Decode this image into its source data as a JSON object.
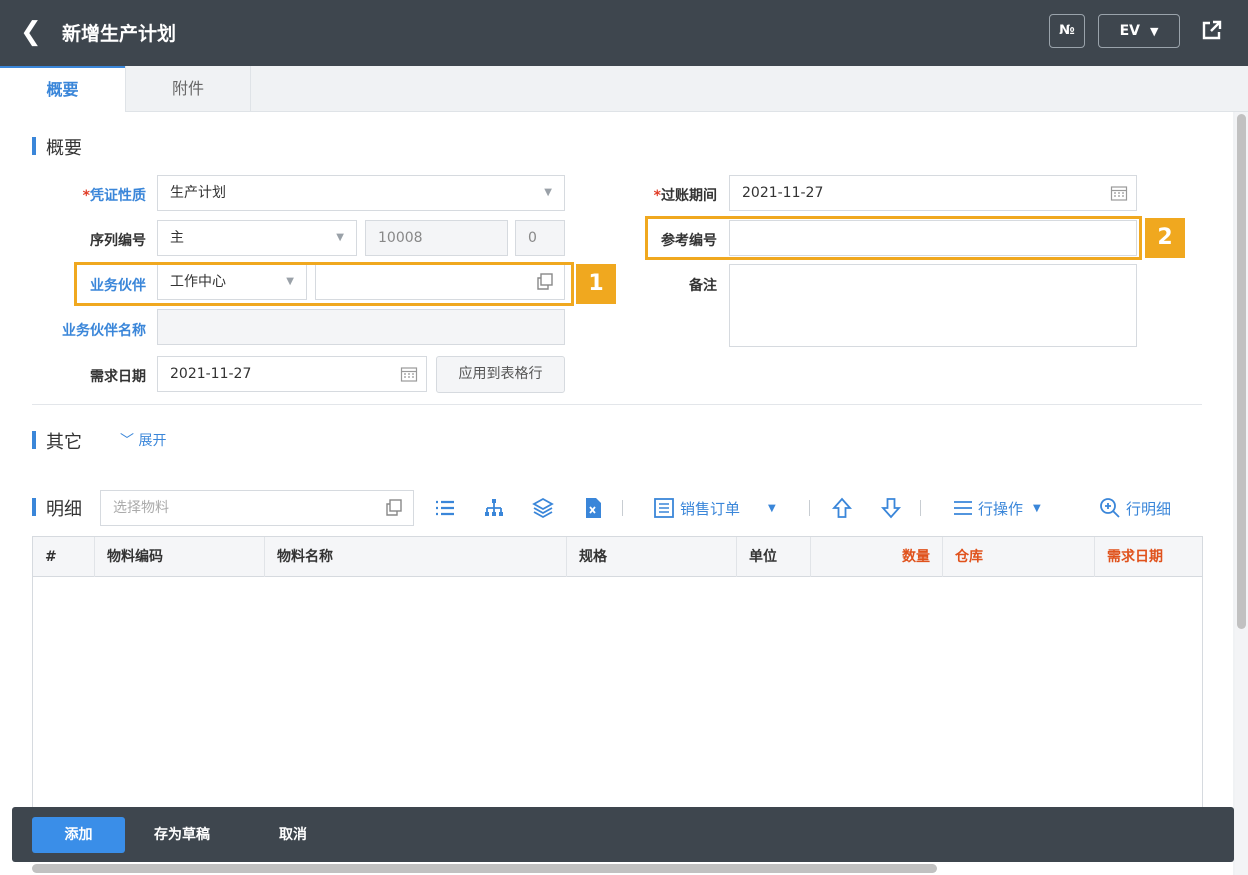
{
  "header": {
    "back": "❮",
    "title": "新增生产计划",
    "no_button": "№",
    "lang_button": "EV"
  },
  "tabs": [
    {
      "label": "概要",
      "active": true
    },
    {
      "label": "附件",
      "active": false
    }
  ],
  "summary": {
    "title": "概要",
    "voucher_type": {
      "label": "凭证性质",
      "required": "*",
      "value": "生产计划"
    },
    "serial": {
      "label": "序列编号",
      "value": "主",
      "number": "10008",
      "suffix": "0"
    },
    "partner": {
      "label": "业务伙伴",
      "type": "工作中心",
      "value": ""
    },
    "partner_name": {
      "label": "业务伙伴名称",
      "value": ""
    },
    "demand_date": {
      "label": "需求日期",
      "value": "2021-11-27"
    },
    "apply_button": "应用到表格行",
    "posting_date": {
      "label": "过账期间",
      "required": "*",
      "value": "2021-11-27"
    },
    "reference": {
      "label": "参考编号",
      "value": ""
    },
    "remark": {
      "label": "备注",
      "value": ""
    }
  },
  "other": {
    "title": "其它",
    "expand": "展开"
  },
  "detail": {
    "title": "明细",
    "search_placeholder": "选择物料",
    "sales_order": "销售订单",
    "row_ops": "行操作",
    "row_detail": "行明细",
    "columns": [
      "#",
      "物料编码",
      "物料名称",
      "规格",
      "单位",
      "数量",
      "仓库",
      "需求日期"
    ],
    "rows": []
  },
  "annotations": {
    "badge1": "1",
    "badge2": "2"
  },
  "footer": {
    "add": "添加",
    "save_draft": "存为草稿",
    "cancel": "取消"
  },
  "colors": {
    "topbar": "#3e464e",
    "accent": "#3a86d9",
    "highlight": "#f0a81f",
    "required": "#e03c26"
  }
}
